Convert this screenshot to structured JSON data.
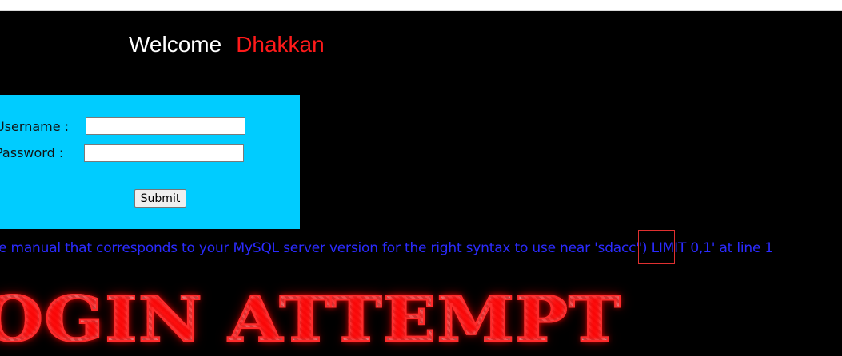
{
  "header": {
    "welcome_label": "Welcome",
    "name_label": "Dhakkan"
  },
  "login_form": {
    "username_label": "Username :",
    "password_label": "Password :",
    "username_value": "",
    "password_value": "",
    "submit_label": "Submit"
  },
  "error": {
    "message": "e manual that corresponds to your MySQL server version for the right syntax to use near 'sdacc\") LIMIT 0,1' at line 1"
  },
  "banner": {
    "text": "OGIN ATTEMPT"
  },
  "colors": {
    "background": "#000000",
    "login_box": "#00ccff",
    "welcome_text": "#ffffff",
    "name_text": "#ff1a1a",
    "error_text": "#2b2bff",
    "highlight_border": "#e03030"
  }
}
